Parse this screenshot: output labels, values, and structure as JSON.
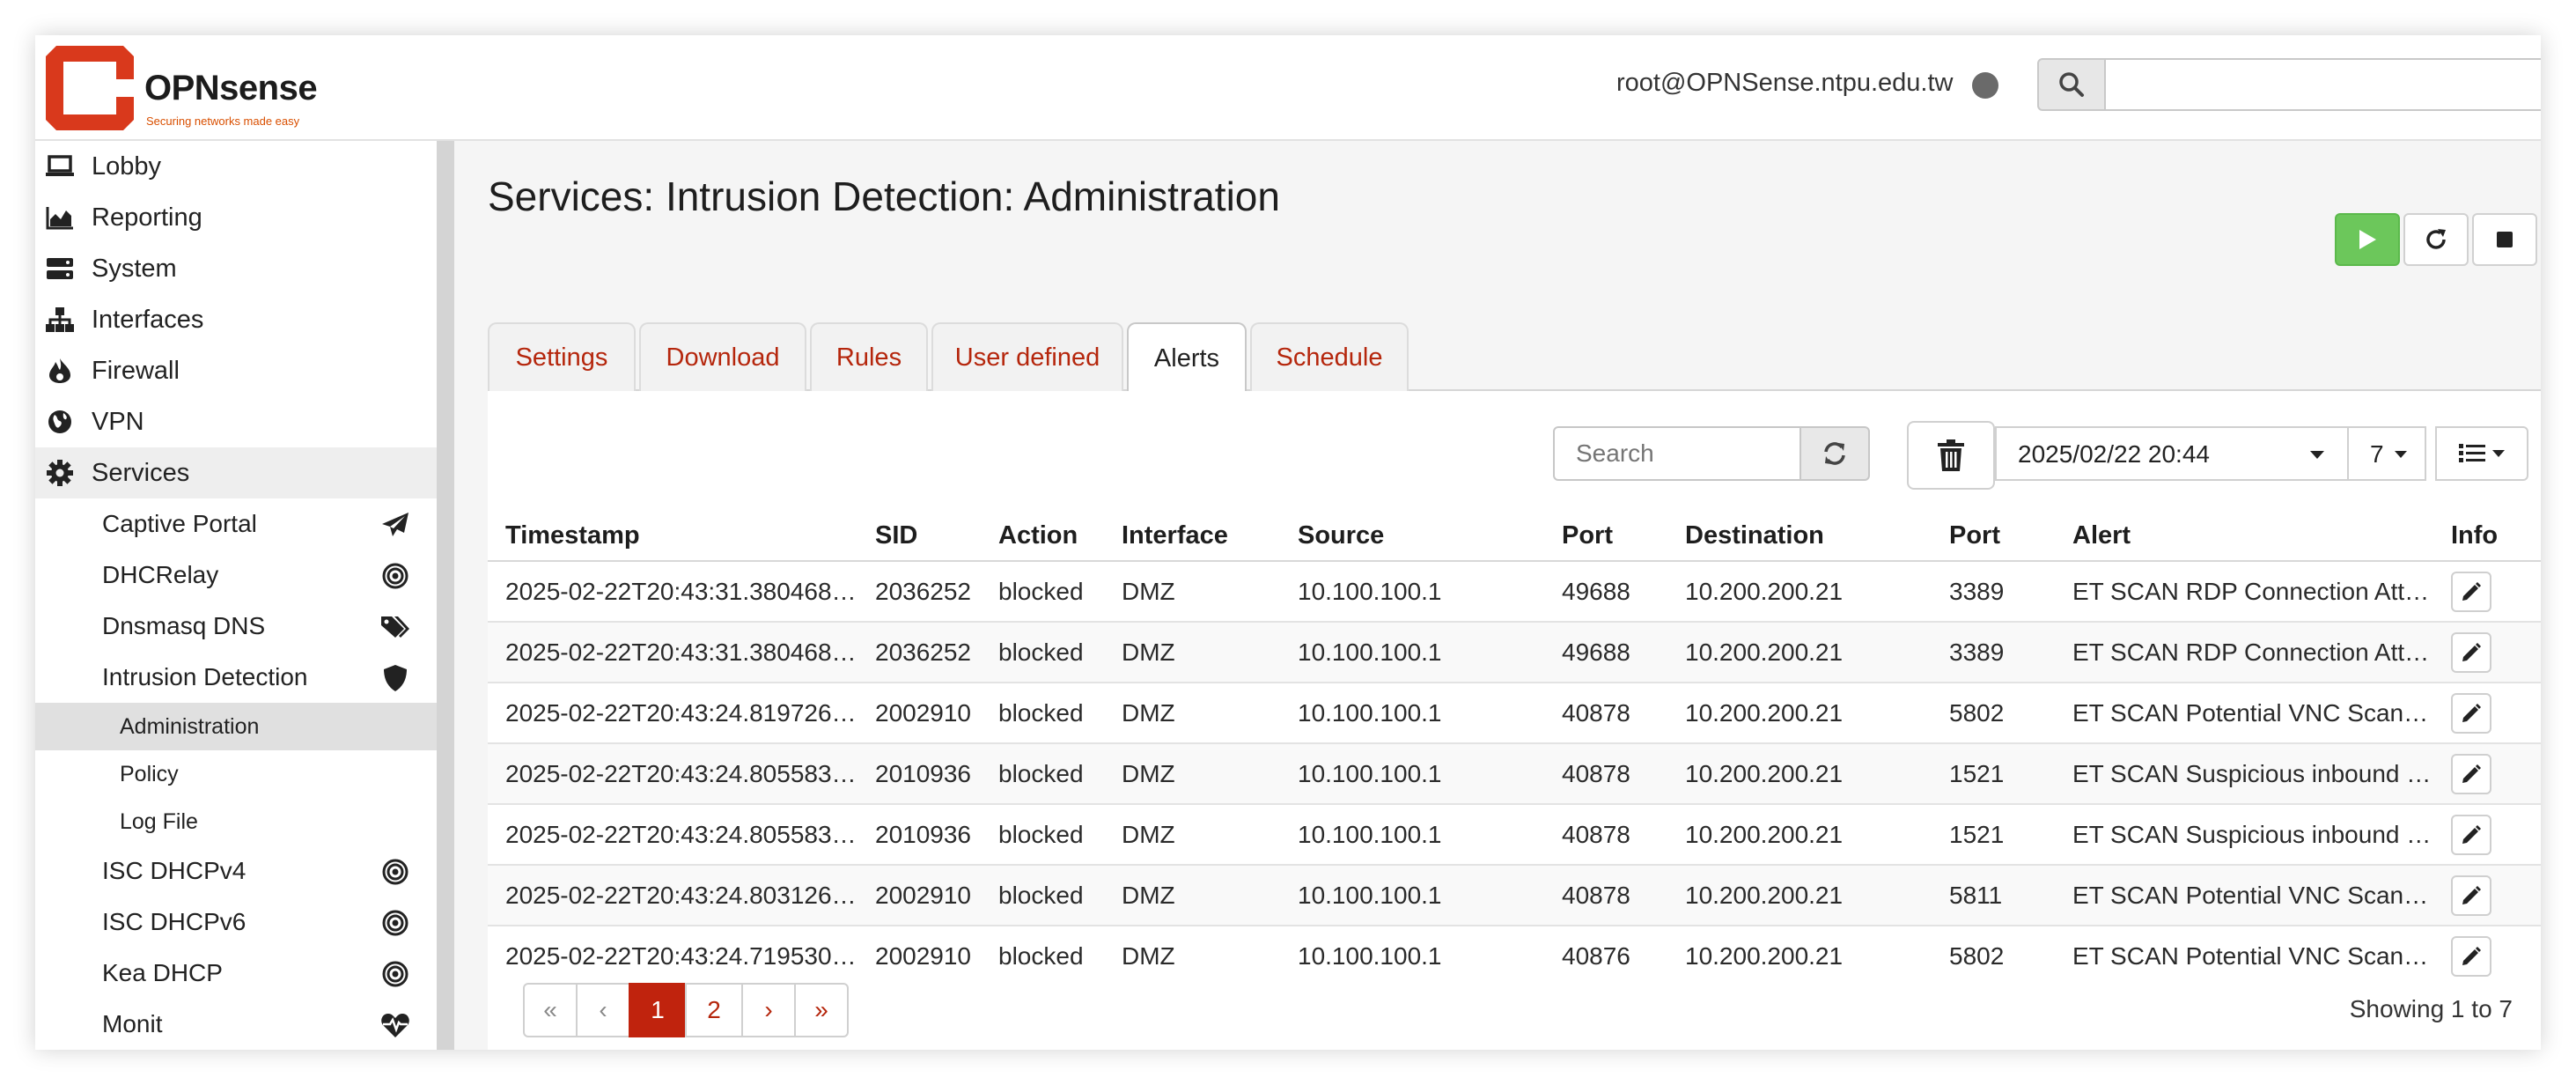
{
  "brand": {
    "name": "OPNsense",
    "tagline": "Securing networks made easy"
  },
  "header": {
    "user": "root@OPNSense.ntpu.edu.tw",
    "search_placeholder": ""
  },
  "sidebar": {
    "top_items": [
      {
        "label": "Lobby",
        "icon": "laptop-icon"
      },
      {
        "label": "Reporting",
        "icon": "area-chart-icon"
      },
      {
        "label": "System",
        "icon": "server-icon"
      },
      {
        "label": "Interfaces",
        "icon": "sitemap-icon"
      },
      {
        "label": "Firewall",
        "icon": "fire-icon"
      },
      {
        "label": "VPN",
        "icon": "globe-icon"
      },
      {
        "label": "Services",
        "icon": "cog-icon"
      }
    ],
    "services_items": [
      {
        "label": "Captive Portal",
        "icon": "paper-plane-icon"
      },
      {
        "label": "DHCRelay",
        "icon": "bullseye-icon"
      },
      {
        "label": "Dnsmasq DNS",
        "icon": "tags-icon"
      },
      {
        "label": "Intrusion Detection",
        "icon": "shield-icon"
      }
    ],
    "ids_items": [
      {
        "label": "Administration"
      },
      {
        "label": "Policy"
      },
      {
        "label": "Log File"
      }
    ],
    "more_items": [
      {
        "label": "ISC DHCPv4",
        "icon": "bullseye-icon"
      },
      {
        "label": "ISC DHCPv6",
        "icon": "bullseye-icon"
      },
      {
        "label": "Kea DHCP",
        "icon": "bullseye-icon"
      },
      {
        "label": "Monit",
        "icon": "heartbeat-icon"
      }
    ]
  },
  "page": {
    "title": "Services: Intrusion Detection: Administration"
  },
  "tabs": [
    {
      "label": "Settings"
    },
    {
      "label": "Download"
    },
    {
      "label": "Rules"
    },
    {
      "label": "User defined"
    },
    {
      "label": "Alerts"
    },
    {
      "label": "Schedule"
    }
  ],
  "active_tab": "Alerts",
  "toolbar": {
    "search_placeholder": "Search",
    "date_value": "2025/02/22 20:44",
    "rows_per_page": "7"
  },
  "table": {
    "columns": [
      "Timestamp",
      "SID",
      "Action",
      "Interface",
      "Source",
      "Port",
      "Destination",
      "Port",
      "Alert",
      "Info"
    ],
    "rows": [
      [
        "2025-02-22T20:43:31.380468+…",
        "2036252",
        "blocked",
        "DMZ",
        "10.100.100.1",
        "49688",
        "10.200.200.21",
        "3389",
        "ET SCAN RDP Connection Atte…"
      ],
      [
        "2025-02-22T20:43:31.380468+…",
        "2036252",
        "blocked",
        "DMZ",
        "10.100.100.1",
        "49688",
        "10.200.200.21",
        "3389",
        "ET SCAN RDP Connection Atte…"
      ],
      [
        "2025-02-22T20:43:24.819726+…",
        "2002910",
        "blocked",
        "DMZ",
        "10.100.100.1",
        "40878",
        "10.200.200.21",
        "5802",
        "ET SCAN Potential VNC Scan 5…"
      ],
      [
        "2025-02-22T20:43:24.805583+…",
        "2010936",
        "blocked",
        "DMZ",
        "10.100.100.1",
        "40878",
        "10.200.200.21",
        "1521",
        "ET SCAN Suspicious inbound t…"
      ],
      [
        "2025-02-22T20:43:24.805583+…",
        "2010936",
        "blocked",
        "DMZ",
        "10.100.100.1",
        "40878",
        "10.200.200.21",
        "1521",
        "ET SCAN Suspicious inbound t…"
      ],
      [
        "2025-02-22T20:43:24.803126+…",
        "2002910",
        "blocked",
        "DMZ",
        "10.100.100.1",
        "40878",
        "10.200.200.21",
        "5811",
        "ET SCAN Potential VNC Scan 5…"
      ],
      [
        "2025-02-22T20:43:24.719530+…",
        "2002910",
        "blocked",
        "DMZ",
        "10.100.100.1",
        "40876",
        "10.200.200.21",
        "5802",
        "ET SCAN Potential VNC Scan 5…"
      ]
    ]
  },
  "pagination": {
    "first": "«",
    "prev": "‹",
    "pages": [
      "1",
      "2"
    ],
    "current": "1",
    "next": "›",
    "last": "»",
    "showing": "Showing 1 to 7"
  },
  "colors": {
    "brand_red": "#c0230d",
    "link_red": "#b5260c",
    "start_green": "#6cc75b"
  }
}
